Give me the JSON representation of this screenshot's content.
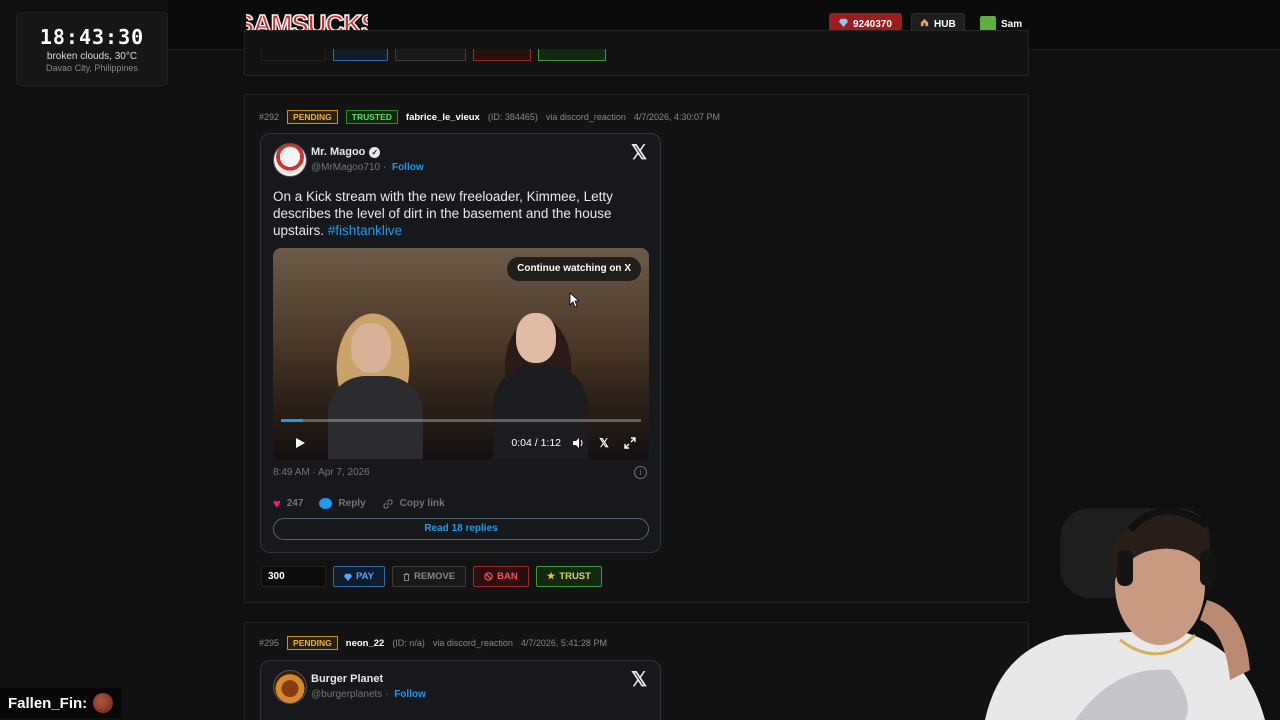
{
  "clock": {
    "time": "18:43:30",
    "weather": "broken clouds, 30°C",
    "location": "Davao City, Philippines"
  },
  "header": {
    "logo_text": "SAMSUCKS",
    "coins": "9240370",
    "hub_label": "HUB",
    "user_name": "Sam"
  },
  "submissions": [
    {
      "id": "#292",
      "status": "PENDING",
      "trust_badge": "TRUSTED",
      "username": "fabrice_le_vieux",
      "user_id": "(ID: 384465)",
      "via": "via discord_reaction",
      "timestamp": "4/7/2026, 4:30:07 PM",
      "tweet": {
        "author": "Mr. Magoo",
        "handle": "@MrMagoo710",
        "follow": "Follow",
        "text": "On a Kick stream with the new freeloader, Kimmee, Letty describes the level of dirt in the basement and the house upstairs.",
        "hashtag": "#fishtanklive",
        "continue_label": "Continue watching on X",
        "video_time": "0:04 / 1:12",
        "video_progress": 0.06,
        "date": "8:49 AM · Apr 7, 2026",
        "likes": "247",
        "reply_label": "Reply",
        "copy_label": "Copy link",
        "read_replies": "Read 18 replies"
      },
      "amount": "300",
      "buttons": {
        "pay": "PAY",
        "remove": "REMOVE",
        "ban": "BAN",
        "trust": "TRUST"
      }
    },
    {
      "id": "#295",
      "status": "PENDING",
      "username": "neon_22",
      "user_id": "(ID: n/a)",
      "via": "via discord_reaction",
      "timestamp": "4/7/2026, 5:41:28 PM",
      "tweet": {
        "author": "Burger Planet",
        "handle": "@burgerplanets",
        "follow": "Follow"
      }
    }
  ],
  "chat": {
    "username": "Fallen_Fin:"
  },
  "colors": {
    "accent": "#1d9bf0",
    "pending": "#f1b529",
    "trusted": "#5edc64",
    "coin_bg": "#9e1c1c"
  }
}
